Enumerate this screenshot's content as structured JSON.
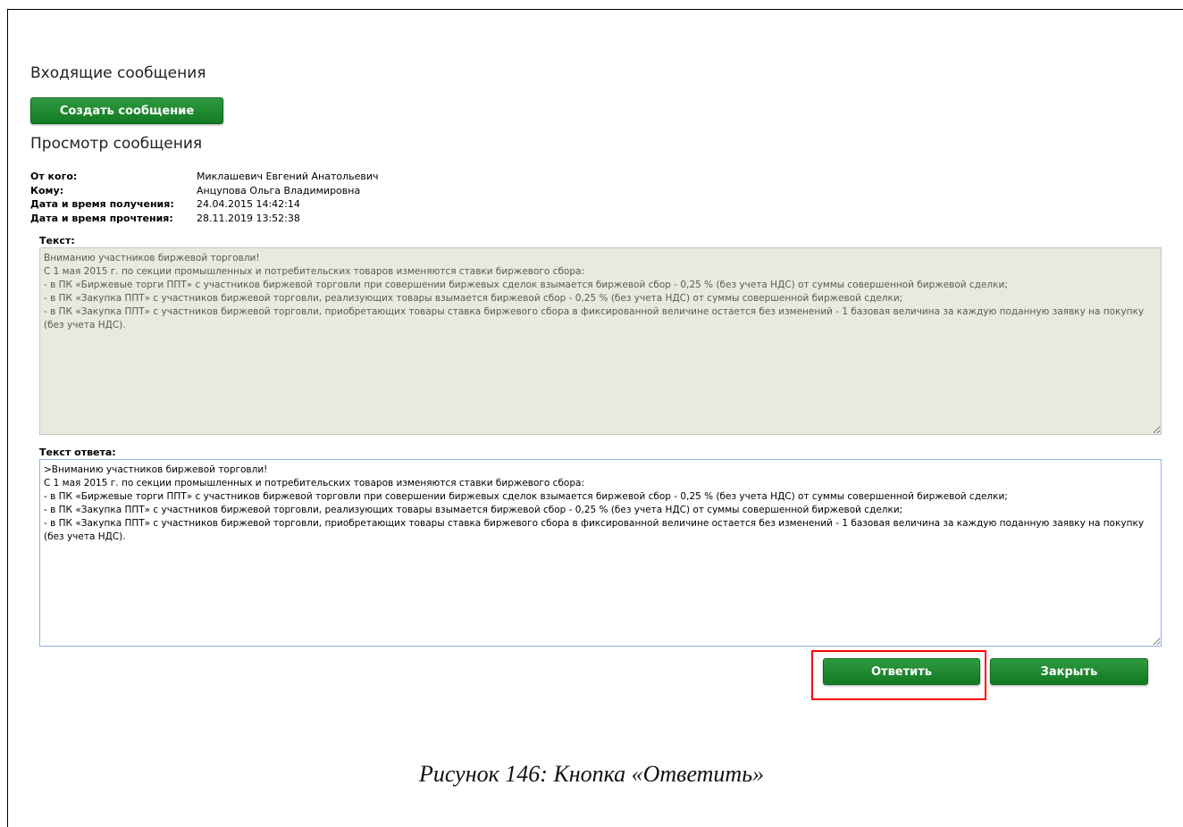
{
  "header": {
    "title": "Входящие сообщения",
    "create_button": "Создать сообщение",
    "view_title": "Просмотр сообщения"
  },
  "meta": [
    {
      "label": "От кого:",
      "value": "Миклашевич Евгений Анатольевич"
    },
    {
      "label": "Кому:",
      "value": "Анцупова Ольга Владимировна"
    },
    {
      "label": "Дата и время получения:",
      "value": "24.04.2015 14:42:14"
    },
    {
      "label": "Дата и время прочтения:",
      "value": "28.11.2019 13:52:38"
    }
  ],
  "message": {
    "label": "Текст:",
    "body": "Вниманию участников биржевой торговли!\nС 1 мая 2015 г. по секции промышленных и потребительских товаров изменяются ставки биржевого сбора:\n- в ПК «Биржевые торги ППТ» с участников биржевой торговли при совершении биржевых сделок взымается биржевой сбор - 0,25 % (без учета НДС) от суммы совершенной биржевой сделки;\n- в ПК «Закупка ППТ» с участников биржевой торговли, реализующих товары взымается биржевой сбор - 0,25 % (без учета НДС) от суммы совершенной биржевой сделки;\n- в ПК «Закупка ППТ» с участников биржевой торговли, приобретающих товары ставка биржевого сбора в фиксированной величине остается без изменений - 1 базовая величина за каждую поданную заявку на покупку (без учета НДС)."
  },
  "reply": {
    "label": "Текст ответа:",
    "body": ">Вниманию участников биржевой торговли!\nС 1 мая 2015 г. по секции промышленных и потребительских товаров изменяются ставки биржевого сбора:\n- в ПК «Биржевые торги ППТ» с участников биржевой торговли при совершении биржевых сделок взымается биржевой сбор - 0,25 % (без учета НДС) от суммы совершенной биржевой сделки;\n- в ПК «Закупка ППТ» с участников биржевой торговли, реализующих товары взымается биржевой сбор - 0,25 % (без учета НДС) от суммы совершенной биржевой сделки;\n- в ПК «Закупка ППТ» с участников биржевой торговли, приобретающих товары ставка биржевого сбора в фиксированной величине остается без изменений - 1 базовая величина за каждую поданную заявку на покупку (без учета НДС).",
    "reply_button": "Ответить",
    "close_button": "Закрыть"
  },
  "caption": "Рисунок 146:  Кнопка «Ответить»",
  "colors": {
    "button_green": "#1a8a2e",
    "highlight_red": "#ff0000",
    "readonly_bg": "#e9e9e2",
    "focus_border": "#8fb1e4"
  }
}
